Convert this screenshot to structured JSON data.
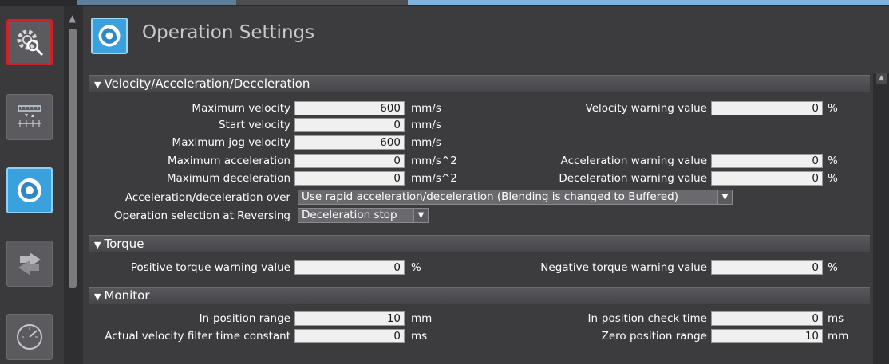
{
  "header": {
    "title": "Operation Settings",
    "icon": "operation-settings-icon"
  },
  "sidebar": {
    "items": [
      {
        "name": "axis-settings-icon",
        "state": "active"
      },
      {
        "name": "unit-conversion-icon",
        "state": "normal"
      },
      {
        "name": "operation-settings-icon",
        "state": "selected"
      },
      {
        "name": "other-operation-icon",
        "state": "normal"
      },
      {
        "name": "limit-settings-icon",
        "state": "normal"
      }
    ]
  },
  "sections": {
    "velocity": {
      "title": "Velocity/Acceleration/Deceleration",
      "max_velocity": {
        "label": "Maximum velocity",
        "value": "600",
        "unit": "mm/s"
      },
      "start_velocity": {
        "label": "Start velocity",
        "value": "0",
        "unit": "mm/s"
      },
      "max_jog_velocity": {
        "label": "Maximum jog velocity",
        "value": "600",
        "unit": "mm/s"
      },
      "max_acceleration": {
        "label": "Maximum acceleration",
        "value": "0",
        "unit": "mm/s^2"
      },
      "max_deceleration": {
        "label": "Maximum deceleration",
        "value": "0",
        "unit": "mm/s^2"
      },
      "accel_over": {
        "label": "Acceleration/deceleration over",
        "value": "Use rapid acceleration/deceleration (Blending is changed to Buffered)"
      },
      "reversing": {
        "label": "Operation selection at Reversing",
        "value": "Deceleration stop"
      },
      "velocity_warning": {
        "label": "Velocity warning value",
        "value": "0",
        "unit": "%"
      },
      "acceleration_warning": {
        "label": "Acceleration warning value",
        "value": "0",
        "unit": "%"
      },
      "deceleration_warning": {
        "label": "Deceleration warning value",
        "value": "0",
        "unit": "%"
      }
    },
    "torque": {
      "title": "Torque",
      "positive_warning": {
        "label": "Positive torque warning value",
        "value": "0",
        "unit": "%"
      },
      "negative_warning": {
        "label": "Negative torque warning value",
        "value": "0",
        "unit": "%"
      }
    },
    "monitor": {
      "title": "Monitor",
      "in_position_range": {
        "label": "In-position range",
        "value": "10",
        "unit": "mm"
      },
      "velocity_filter": {
        "label": "Actual velocity filter time constant",
        "value": "0",
        "unit": "ms"
      },
      "in_position_check_time": {
        "label": "In-position check time",
        "value": "0",
        "unit": "ms"
      },
      "zero_position_range": {
        "label": "Zero position range",
        "value": "10",
        "unit": "mm"
      }
    }
  },
  "colors": {
    "accent": "#3aa1df",
    "active_border": "#d0202a",
    "background": "#3c3c3e"
  }
}
